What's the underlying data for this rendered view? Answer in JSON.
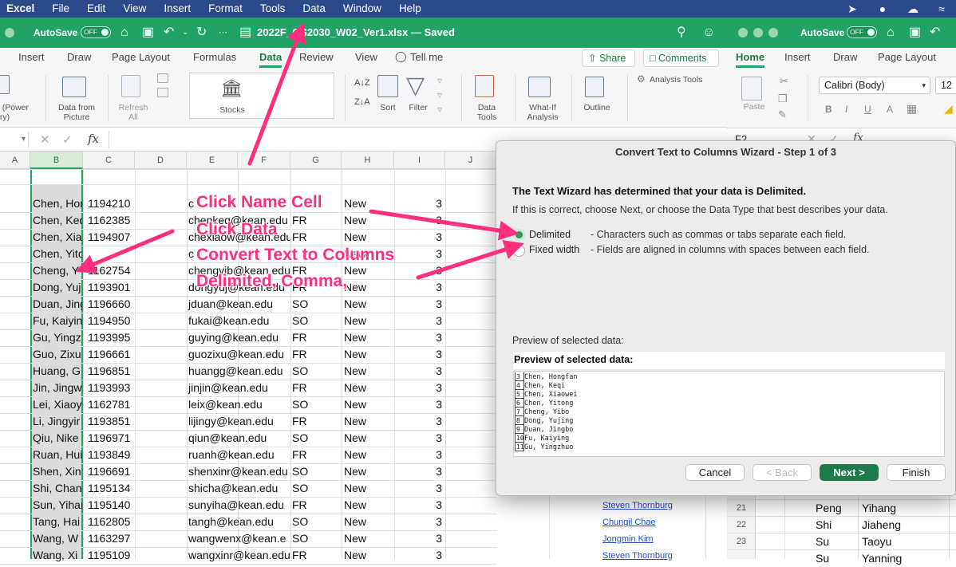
{
  "menubar": {
    "items": [
      "Excel",
      "File",
      "Edit",
      "View",
      "Insert",
      "Format",
      "Tools",
      "Data",
      "Window",
      "Help"
    ]
  },
  "window_left": {
    "autosave_label": "AutoSave",
    "toggle_label": "OFF",
    "doc_title": "2022F_GS2030_W02_Ver1.xlsx — Saved",
    "tabs": [
      "Insert",
      "Draw",
      "Page Layout",
      "Formulas",
      "Data",
      "Review",
      "View"
    ],
    "tell_me": "Tell me",
    "share": "Share",
    "comments": "Comments",
    "ribbon": {
      "get_data": "a (Power\nery)",
      "data_from_picture": "Data from\nPicture",
      "refresh_all": "Refresh\nAll",
      "stocks": "Stocks",
      "sort": "Sort",
      "filter": "Filter",
      "data_tools": "Data\nTools",
      "what_if": "What-If\nAnalysis",
      "outline": "Outline",
      "analysis_tools": "Analysis Tools"
    },
    "formula_fx": "fx",
    "columns": [
      "A",
      "B",
      "C",
      "D",
      "E",
      "F",
      "G",
      "H",
      "I",
      "J"
    ],
    "rows": [
      {
        "name": "Chen, Hon",
        "id": "1194210",
        "email": "c",
        "year": "",
        "status": "New",
        "n": "3"
      },
      {
        "name": "Chen, Keq",
        "id": "1162385",
        "email": "chenkeq@kean.edu",
        "year": "FR",
        "status": "New",
        "n": "3"
      },
      {
        "name": "Chen, Xiao",
        "id": "1194907",
        "email": "chexiaow@kean.edu",
        "year": "FR",
        "status": "New",
        "n": "3"
      },
      {
        "name": "Chen, Yito",
        "id": "",
        "email": "c",
        "year": "",
        "status": "New",
        "n": "3"
      },
      {
        "name": "Cheng, Y",
        "id": "1162754",
        "email": "chengyib@kean.edu",
        "year": "FR",
        "status": "New",
        "n": "3"
      },
      {
        "name": "Dong, Yuj",
        "id": "1193901",
        "email": "dongyuj@kean.edu",
        "year": "FR",
        "status": "New",
        "n": "3"
      },
      {
        "name": "Duan, Jing",
        "id": "1196660",
        "email": "jduan@kean.edu",
        "year": "SO",
        "status": "New",
        "n": "3"
      },
      {
        "name": "Fu, Kaiyin",
        "id": "1194950",
        "email": "fukai@kean.edu",
        "year": "SO",
        "status": "New",
        "n": "3"
      },
      {
        "name": "Gu, Yingz",
        "id": "1193995",
        "email": "guying@kean.edu",
        "year": "FR",
        "status": "New",
        "n": "3"
      },
      {
        "name": "Guo, Zixu",
        "id": "1196661",
        "email": "guozixu@kean.edu",
        "year": "FR",
        "status": "New",
        "n": "3"
      },
      {
        "name": "Huang, G",
        "id": "1196851",
        "email": "huangg@kean.edu",
        "year": "SO",
        "status": "New",
        "n": "3"
      },
      {
        "name": "Jin, Jingw",
        "id": "1193993",
        "email": "jinjin@kean.edu",
        "year": "FR",
        "status": "New",
        "n": "3"
      },
      {
        "name": "Lei, Xiaoy",
        "id": "1162781",
        "email": "leix@kean.edu",
        "year": "SO",
        "status": "New",
        "n": "3"
      },
      {
        "name": "Li, Jingyir",
        "id": "1193851",
        "email": "lijingy@kean.edu",
        "year": "FR",
        "status": "New",
        "n": "3"
      },
      {
        "name": "Qiu, Nike",
        "id": "1196971",
        "email": "qiun@kean.edu",
        "year": "SO",
        "status": "New",
        "n": "3"
      },
      {
        "name": "Ruan, Hui",
        "id": "1193849",
        "email": "ruanh@kean.edu",
        "year": "FR",
        "status": "New",
        "n": "3"
      },
      {
        "name": "Shen, Xin",
        "id": "1196691",
        "email": "shenxinr@kean.edu",
        "year": "SO",
        "status": "New",
        "n": "3"
      },
      {
        "name": "Shi, Chan",
        "id": "1195134",
        "email": "shicha@kean.edu",
        "year": "SO",
        "status": "New",
        "n": "3"
      },
      {
        "name": "Sun, Yihar",
        "id": "1195140",
        "email": "sunyiha@kean.edu",
        "year": "FR",
        "status": "New",
        "n": "3"
      },
      {
        "name": "Tang, Hai",
        "id": "1162805",
        "email": "tangh@kean.edu",
        "year": "SO",
        "status": "New",
        "n": "3"
      },
      {
        "name": "Wang, W",
        "id": "1163297",
        "email": "wangwenx@kean.e",
        "year": "SO",
        "status": "New",
        "n": "3"
      },
      {
        "name": "Wang, Xi",
        "id": "1195109",
        "email": "wangxinr@kean.edu",
        "year": "FR",
        "status": "New",
        "n": "3"
      }
    ],
    "links": [
      "Steven Thornburg",
      "Chungil Chae",
      "Jongmin Kim",
      "Steven Thornburg"
    ]
  },
  "window_right": {
    "autosave_label": "AutoSave",
    "toggle_label": "OFF",
    "tabs": [
      "Home",
      "Insert",
      "Draw",
      "Page Layout"
    ],
    "font_name": "Calibri (Body)",
    "font_size": "12",
    "paste": "Paste",
    "cell_ref": "F2",
    "rows": [
      {
        "num": "21",
        "last": "Peng",
        "first": "Yihang"
      },
      {
        "num": "22",
        "last": "Shi",
        "first": "Jiaheng"
      },
      {
        "num": "23",
        "last": "Su",
        "first": "Taoyu"
      },
      {
        "num": "",
        "last": "Su",
        "first": "Yanning"
      }
    ]
  },
  "annotations": {
    "line1": "Click Name Cell",
    "line2": "Click Data",
    "line3": "Convert Text to Columns",
    "line4": "Delimited, Comma,",
    "color": "#ff2f7d"
  },
  "dialog": {
    "title": "Convert Text to Columns Wizard - Step 1 of 3",
    "heading": "The Text Wizard has determined that your data is Delimited.",
    "subtext": "If this is correct, choose Next, or choose the Data Type that best describes your data.",
    "option1_label": "Delimited",
    "option1_desc": "- Characters such as commas or tabs separate each field.",
    "option2_label": "Fixed width",
    "option2_desc": "- Fields are aligned in columns with spaces between each field.",
    "preview_label": "Preview of selected data:",
    "preview_header": "Preview of selected data:",
    "preview_rows": [
      {
        "n": "3",
        "text": "Chen, Hongfan"
      },
      {
        "n": "4",
        "text": "Chen, Keqi"
      },
      {
        "n": "5",
        "text": "Chen, Xiaowei"
      },
      {
        "n": "6",
        "text": "Chen, Yitong"
      },
      {
        "n": "7",
        "text": "Cheng, Yibo"
      },
      {
        "n": "8",
        "text": "Dong, Yujing"
      },
      {
        "n": "9",
        "text": "Duan, Jingbo"
      },
      {
        "n": "10",
        "text": "Fu, Kaiying"
      },
      {
        "n": "11",
        "text": "Gu, Yingzhuo"
      }
    ],
    "cancel": "Cancel",
    "back": "< Back",
    "next": "Next >",
    "finish": "Finish"
  }
}
